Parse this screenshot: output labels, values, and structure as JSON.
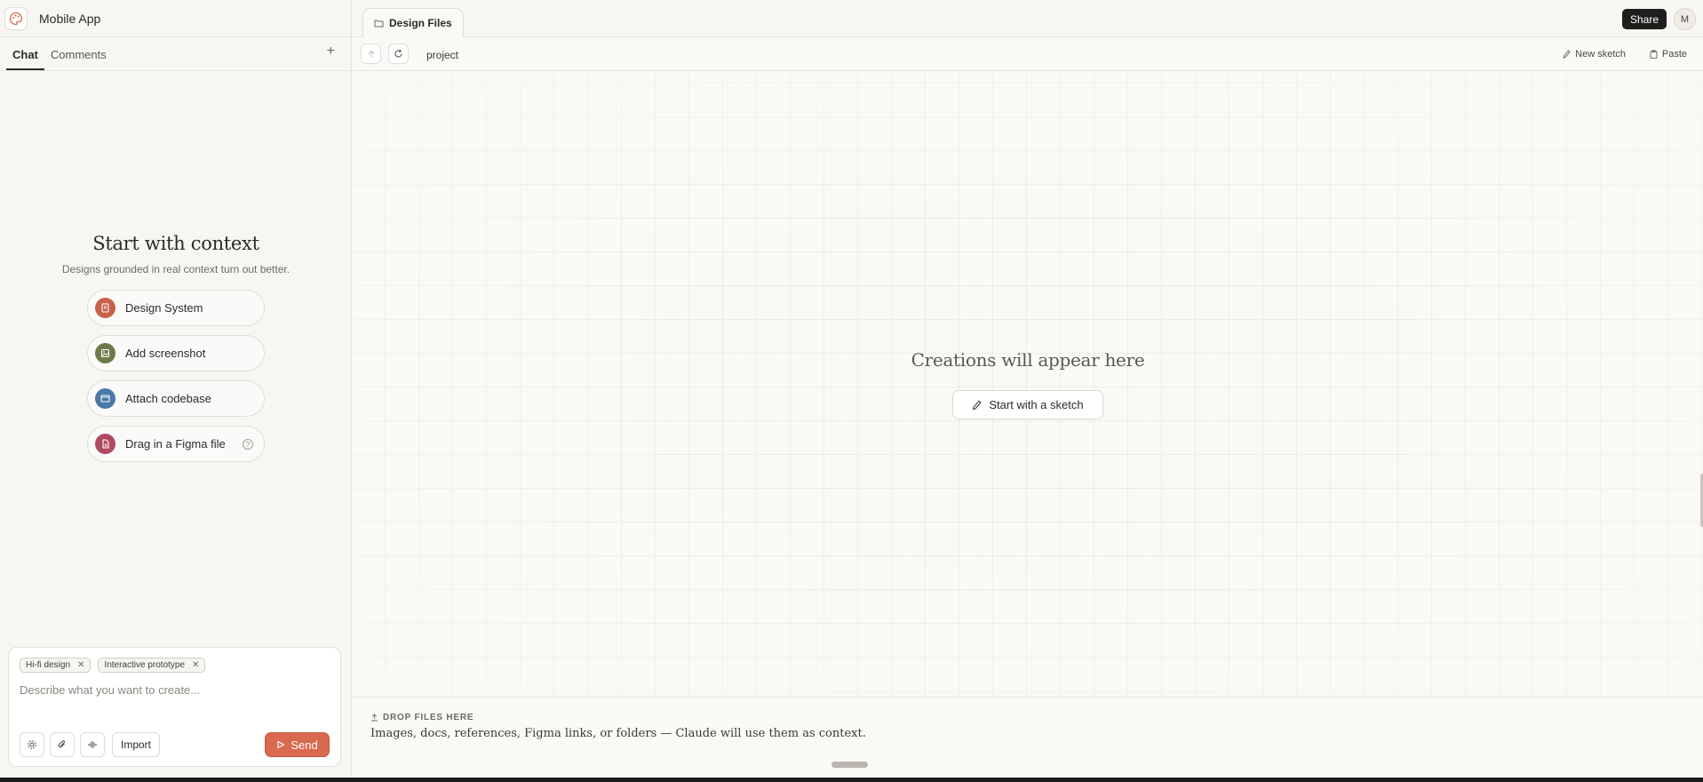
{
  "app": {
    "project_name": "Mobile App"
  },
  "left_panel": {
    "tabs": [
      {
        "label": "Chat",
        "active": true
      },
      {
        "label": "Comments",
        "active": false
      }
    ],
    "add_label": "+",
    "context": {
      "title": "Start with context",
      "subtitle": "Designs grounded in real context turn out better.",
      "items": [
        {
          "label": "Design System",
          "icon": "book-icon",
          "color": "#c8614a"
        },
        {
          "label": "Add screenshot",
          "icon": "image-icon",
          "color": "#6b7a4c"
        },
        {
          "label": "Attach codebase",
          "icon": "code-window-icon",
          "color": "#4a78a8"
        },
        {
          "label": "Drag in a Figma file",
          "icon": "file-icon",
          "color": "#b04a62",
          "help": "?"
        }
      ]
    },
    "composer": {
      "chips": [
        {
          "label": "Hi-fi design"
        },
        {
          "label": "Interactive prototype"
        }
      ],
      "placeholder": "Describe what you want to create...",
      "import_label": "Import",
      "send_label": "Send"
    }
  },
  "right_panel": {
    "file_tab": "Design Files",
    "share_label": "Share",
    "avatar_initial": "M",
    "path": "project",
    "actions": {
      "new_sketch": "New sketch",
      "paste": "Paste"
    },
    "empty_state": {
      "title": "Creations will appear here",
      "button": "Start with a sketch"
    },
    "drop_zone": {
      "title": "DROP FILES HERE",
      "description": "Images, docs, references, Figma links, or folders — Claude will use them as context."
    }
  },
  "colors": {
    "accent": "#d9694f",
    "background": "#faf9f6",
    "dark": "#1f1e1c"
  }
}
